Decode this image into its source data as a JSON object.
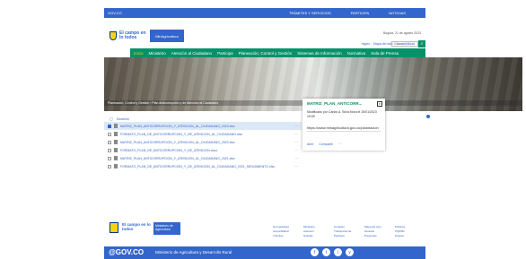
{
  "topbar": {
    "gov_link": "GOV.CO",
    "nav": [
      "TRÁMITES Y SERVICIOS",
      "PARTICIPA",
      "NOTICIAS"
    ]
  },
  "header": {
    "logo_potencia": "El campo en lo todos",
    "logo_ministry": "MinAgricultura",
    "date": "Bogotá, 21 de agosto 2023",
    "util_links": [
      "Inglés",
      "Mapa del sitio",
      "Accesibilidad"
    ],
    "search_placeholder": "Buscar"
  },
  "mainnav": {
    "items": [
      "Inicio",
      "Ministerio",
      "Atención al Ciudadano",
      "Participa",
      "Planeación, Control y Gestión",
      "Sistemas de Información",
      "Normativa",
      "Sala de Prensa"
    ]
  },
  "hero": {
    "breadcrumb": "Planeación, Control y Gestión › Plan Anticorrupción y de Atención al Ciudadano"
  },
  "filelist": {
    "toolbar": {
      "name_header": "Nombre"
    },
    "files": [
      {
        "name": "MATRIZ_PLAN_ANTICORRUPCION_Y_ATENCION_AL_CIUDADANO_2023.xlsx",
        "more": "···",
        "selected": true
      },
      {
        "name": "FORMATO_PLAN_DE_ANTICORRUPCION_Y_DE_ATENCION_AL_CIUDADANO.xlsx",
        "more": "···",
        "selected": false
      },
      {
        "name": "MATRIZ_PLAN_ANTICORRUPCION_Y_ATENCION_AL_CIUDADANO_2022.xlsx",
        "more": "···",
        "selected": false
      },
      {
        "name": "FORMATO_PLAN_DE_ANTICORRUPCION_Y_DE_ATENCION.docx",
        "more": "···",
        "selected": false
      },
      {
        "name": "MATRIZ_PLAN_ANTICORRUPCION_Y_ATENCION_AL_CIUDADANO_2021.xlsx",
        "more": "···",
        "selected": false
      },
      {
        "name": "FORMATO_PLAN_DE_ANTICORRUPCION_Y_DE_ATENCION_AL_CIUDADANO_2021_SEGUIMIENTO.xlsx",
        "more": "···",
        "selected": false
      }
    ]
  },
  "popup": {
    "title": "MATRIZ_PLAN_ANTICORR...",
    "desc": "Modificado por Carlos A. Silva Mora el 15/01/2023 15:09",
    "url": "https://www.minagricultura.gov.co/planeacion",
    "actions": [
      "Abrir",
      "Compartir",
      "···"
    ]
  },
  "footer": {
    "logo_potencia": "El campo en lo todos",
    "logo_ministry": "Ministerio de Agricultura",
    "links": [
      "Normatividad",
      "Ministerio",
      "Contacto",
      "Mapa del sitio",
      "Políticas",
      "Accesibilidad",
      "Atención",
      "Transparencia",
      "Glosario",
      "PQRSD",
      "Trámites",
      "Noticias",
      "Participa",
      "Preguntas",
      "Empleo"
    ]
  },
  "bottombar": {
    "govco": "@GOV.CO",
    "ministry": "Ministerio de Agricultura y Desarrollo Rural",
    "social": [
      "f",
      "t",
      "i",
      "y"
    ]
  },
  "colors": {
    "primary": "#3366cc",
    "green": "#069169",
    "yellow": "#fbd116"
  }
}
